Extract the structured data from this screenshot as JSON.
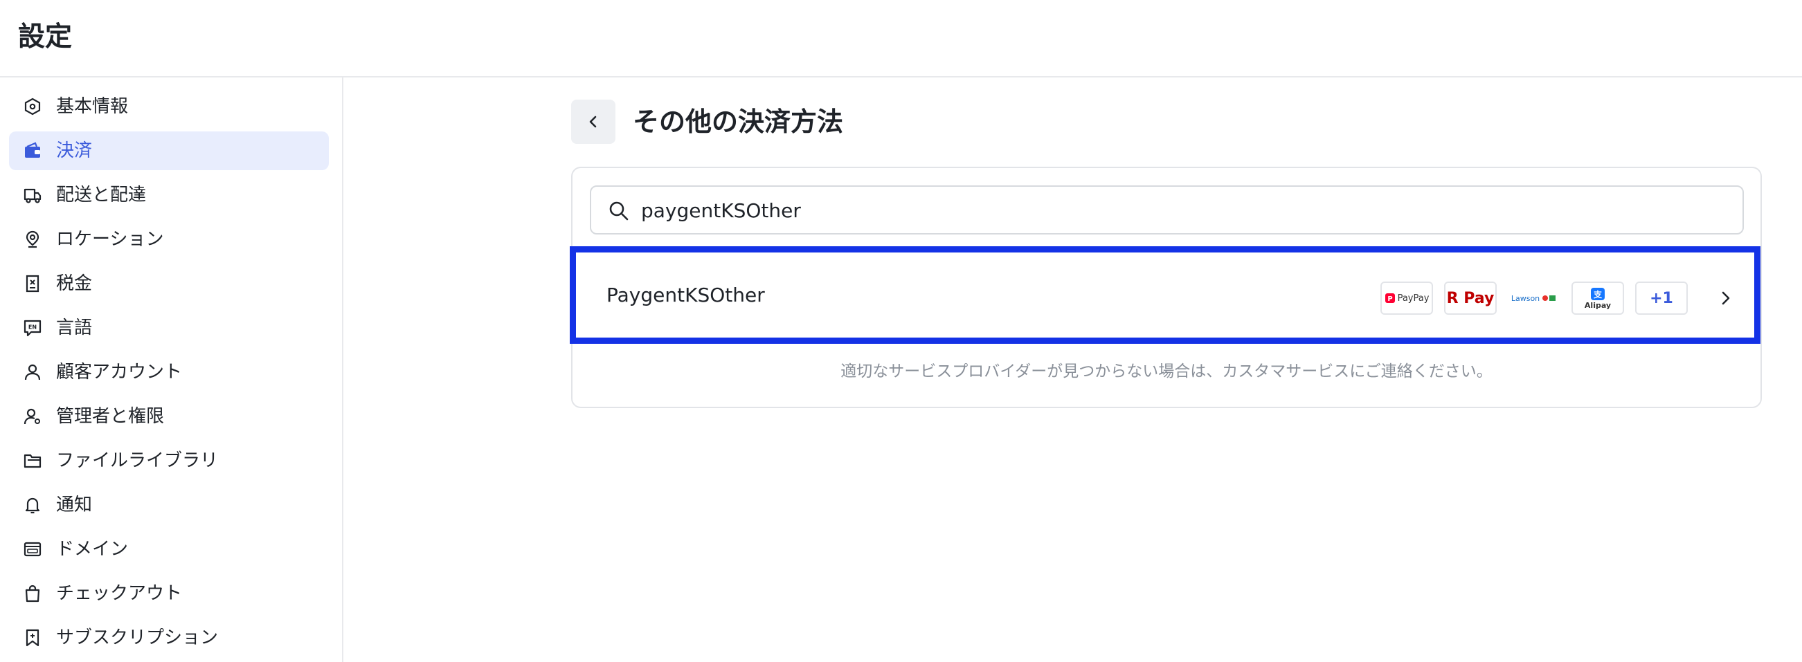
{
  "page": {
    "title": "設定"
  },
  "sidebar": {
    "items": [
      {
        "label": "基本情報",
        "icon": "hexagon-info-icon",
        "active": false
      },
      {
        "label": "決済",
        "icon": "wallet-icon",
        "active": true
      },
      {
        "label": "配送と配達",
        "icon": "truck-icon",
        "active": false
      },
      {
        "label": "ロケーション",
        "icon": "location-pin-icon",
        "active": false
      },
      {
        "label": "税金",
        "icon": "tax-receipt-icon",
        "active": false
      },
      {
        "label": "言語",
        "icon": "language-en-icon",
        "active": false
      },
      {
        "label": "顧客アカウント",
        "icon": "user-icon",
        "active": false
      },
      {
        "label": "管理者と権限",
        "icon": "user-gear-icon",
        "active": false
      },
      {
        "label": "ファイルライブラリ",
        "icon": "folder-icon",
        "active": false
      },
      {
        "label": "通知",
        "icon": "bell-icon",
        "active": false
      },
      {
        "label": "ドメイン",
        "icon": "domain-browser-icon",
        "active": false
      },
      {
        "label": "チェックアウト",
        "icon": "shopping-bag-icon",
        "active": false
      },
      {
        "label": "サブスクリプション",
        "icon": "subscription-bookmark-icon",
        "active": false
      }
    ]
  },
  "main": {
    "title": "その他の決済方法",
    "back_icon": "chevron-left-icon",
    "search": {
      "value": "paygentKSOther",
      "placeholder": ""
    },
    "provider": {
      "name": "PaygentKSOther",
      "logos": [
        {
          "name": "paypay-logo",
          "text": "PayPay"
        },
        {
          "name": "rakuten-pay-logo",
          "text": "R Pay"
        },
        {
          "name": "convenience-store-logo",
          "text": "Lawson"
        },
        {
          "name": "alipay-logo",
          "text": "Alipay"
        }
      ],
      "more": "+1"
    },
    "footer_note": "適切なサービスプロバイダーが見つからない場合は、カスタマサービスにご連絡ください。"
  },
  "colors": {
    "accent": "#3b5bdb",
    "active_bg": "#e8edfd",
    "highlight_border": "#1432e6",
    "muted_text": "#8a9099"
  }
}
